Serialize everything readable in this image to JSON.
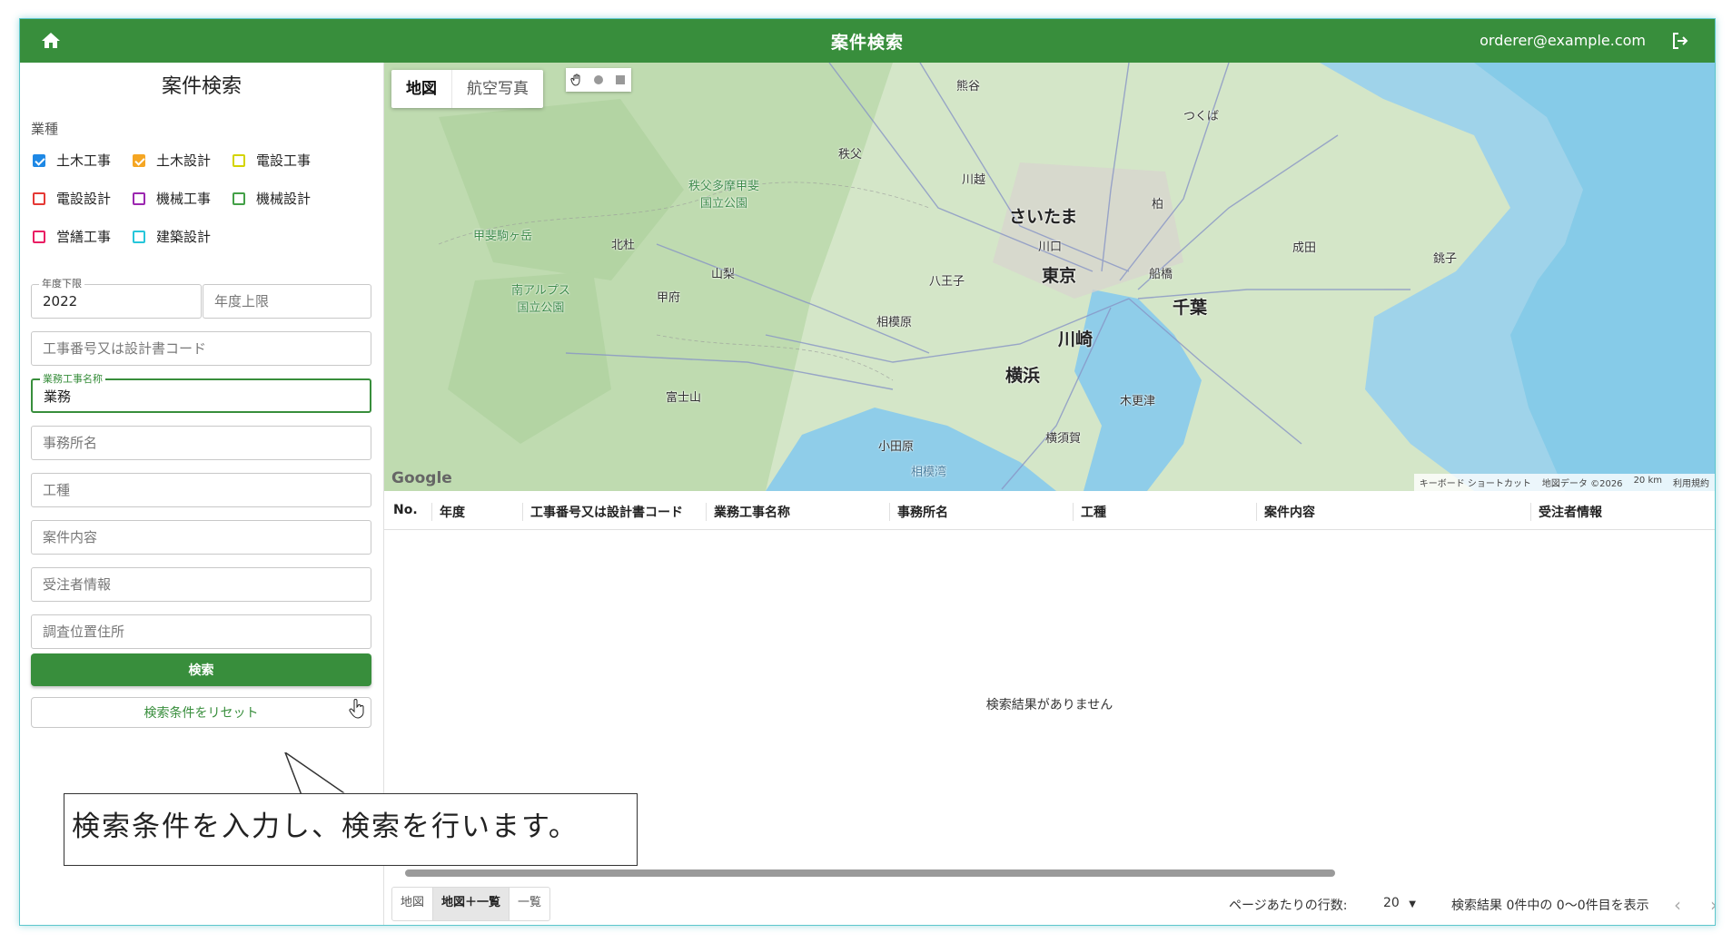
{
  "header": {
    "title": "案件検索",
    "user_email": "orderer@example.com",
    "bg_color": "#388e3c"
  },
  "panel": {
    "title": "案件検索",
    "category_label": "業種",
    "categories": [
      {
        "label": "土木工事",
        "checked": true,
        "color": "#1e88e5"
      },
      {
        "label": "土木設計",
        "checked": true,
        "color": "#f5a623"
      },
      {
        "label": "電設工事",
        "checked": false,
        "color": "#d4d400"
      },
      {
        "label": "電設設計",
        "checked": false,
        "color": "#e53935"
      },
      {
        "label": "機械工事",
        "checked": false,
        "color": "#9c27b0"
      },
      {
        "label": "機械設計",
        "checked": false,
        "color": "#43a047"
      },
      {
        "label": "営繕工事",
        "checked": false,
        "color": "#e91e63"
      },
      {
        "label": "建築設計",
        "checked": false,
        "color": "#26c6da"
      }
    ],
    "year_min": {
      "label": "年度下限",
      "value": "2022"
    },
    "year_max": {
      "placeholder": "年度上限"
    },
    "fields": {
      "code": {
        "placeholder": "工事番号又は設計書コード"
      },
      "name": {
        "label": "業務工事名称",
        "value": "業務"
      },
      "office": {
        "placeholder": "事務所名"
      },
      "work_type": {
        "placeholder": "工種"
      },
      "content": {
        "placeholder": "案件内容"
      },
      "contractor": {
        "placeholder": "受注者情報"
      },
      "address": {
        "placeholder": "調査位置住所"
      }
    },
    "search_button": "検索",
    "reset_button": "検索条件をリセット"
  },
  "map": {
    "type_tabs": [
      "地図",
      "航空写真"
    ],
    "active_tab": "地図",
    "draw_tools": [
      "hand-icon",
      "circle-icon",
      "square-icon"
    ],
    "labels": {
      "tokyo": "東京",
      "saitama": "さいたま",
      "chiba": "千葉",
      "kawasaki": "川崎",
      "yokohama": "横浜",
      "hachioji": "八王子",
      "sagamihara": "相模原",
      "kawaguchi": "川口",
      "funabashi": "船橋",
      "yokosuka": "横須賀",
      "kawagoe": "川越",
      "chichibu": "秩父",
      "fujisan": "富士山",
      "kofu": "甲府",
      "narita": "成田",
      "kisarazu": "木更津",
      "odawara": "小田原",
      "kashiwa": "柏",
      "tsukuba": "つくば",
      "choshi": "銚子",
      "yamanashi": "山梨",
      "hokuto": "北杜",
      "kumagaya": "熊谷",
      "kaidakoma": "甲斐駒ヶ岳",
      "park1": "秩父多摩甲斐\n国立公園",
      "park2": "南アルプス\n国立公園",
      "sagamiwan": "相模湾"
    },
    "attribution": [
      "キーボード ショートカット",
      "地図データ ©2026",
      "20 km",
      "利用規約"
    ],
    "google_logo": "Google"
  },
  "table": {
    "columns": [
      "No.",
      "年度",
      "工事番号又は設計書コード",
      "業務工事名称",
      "事務所名",
      "工種",
      "案件内容",
      "受注者情報"
    ],
    "empty_message": "検索結果がありません"
  },
  "footer": {
    "view_modes": [
      "地図",
      "地図＋一覧",
      "一覧"
    ],
    "active_view": "地図＋一覧",
    "rows_per_page_label": "ページあたりの行数:",
    "rows_per_page": "20",
    "range_text": "検索結果 0件中の 0〜0件目を表示"
  },
  "callout": {
    "text": "検索条件を入力し、検索を行います。"
  }
}
